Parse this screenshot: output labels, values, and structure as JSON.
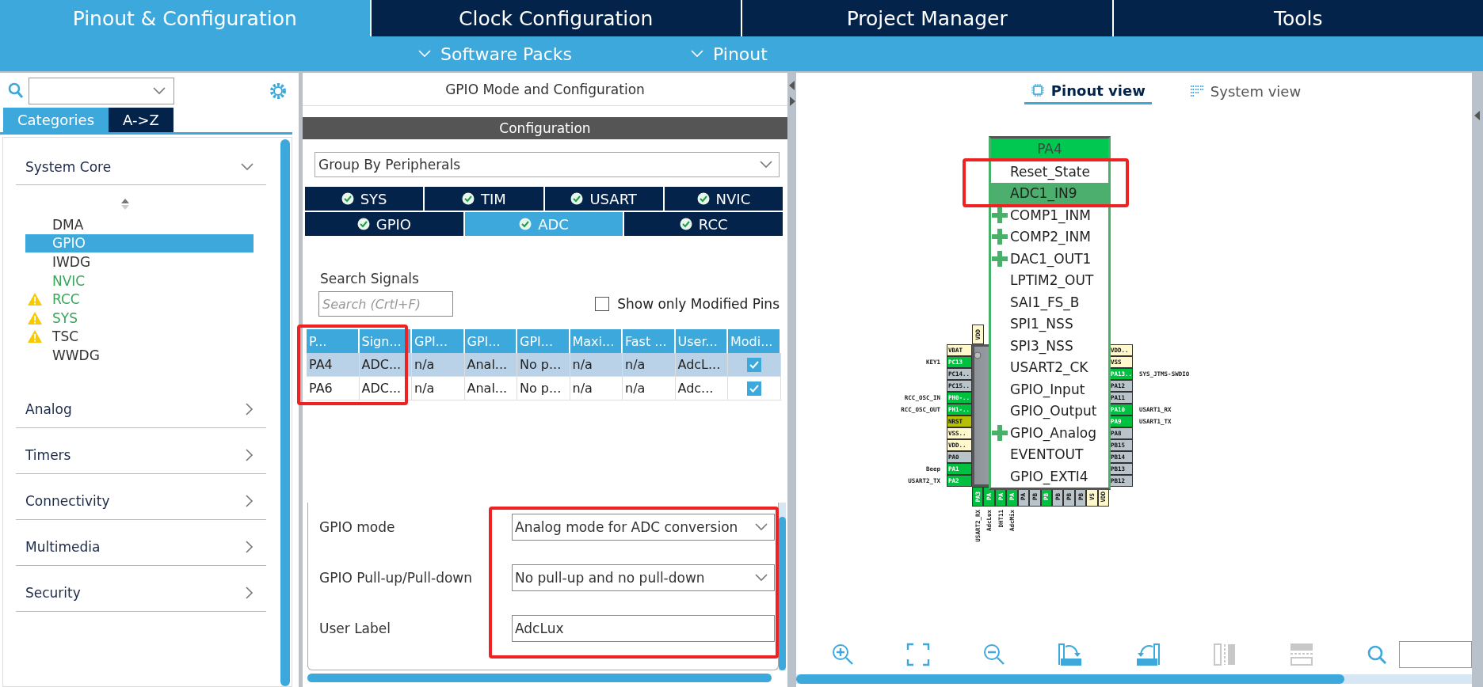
{
  "top_tabs": [
    {
      "label": "Pinout & Configuration",
      "selected": true
    },
    {
      "label": "Clock Configuration",
      "selected": false
    },
    {
      "label": "Project Manager",
      "selected": false
    },
    {
      "label": "Tools",
      "selected": false
    }
  ],
  "sub_menu": [
    {
      "label": "Software Packs"
    },
    {
      "label": "Pinout"
    }
  ],
  "left_tabs": [
    {
      "label": "Categories",
      "selected": true
    },
    {
      "label": "A->Z",
      "selected": false
    }
  ],
  "categories": [
    {
      "label": "System Core",
      "expanded": true,
      "items": [
        {
          "label": "DMA",
          "selected": false,
          "configured": false,
          "warning": false
        },
        {
          "label": "GPIO",
          "selected": true,
          "configured": false,
          "warning": false
        },
        {
          "label": "IWDG",
          "selected": false,
          "configured": false,
          "warning": false
        },
        {
          "label": "NVIC",
          "selected": false,
          "configured": true,
          "warning": false
        },
        {
          "label": "RCC",
          "selected": false,
          "configured": true,
          "warning": true
        },
        {
          "label": "SYS",
          "selected": false,
          "configured": true,
          "warning": true
        },
        {
          "label": "TSC",
          "selected": false,
          "configured": false,
          "warning": true
        },
        {
          "label": "WWDG",
          "selected": false,
          "configured": false,
          "warning": false
        }
      ]
    },
    {
      "label": "Analog",
      "expanded": false
    },
    {
      "label": "Timers",
      "expanded": false
    },
    {
      "label": "Connectivity",
      "expanded": false
    },
    {
      "label": "Multimedia",
      "expanded": false
    },
    {
      "label": "Security",
      "expanded": false
    }
  ],
  "middle": {
    "title": "GPIO Mode and Configuration",
    "section": "Configuration",
    "group_by": "Group By Peripherals",
    "peripheral_tabs": [
      [
        {
          "label": "SYS",
          "selected": false
        },
        {
          "label": "TIM",
          "selected": false
        },
        {
          "label": "USART",
          "selected": false
        },
        {
          "label": "NVIC",
          "selected": false
        }
      ],
      [
        {
          "label": "GPIO",
          "selected": false
        },
        {
          "label": "ADC",
          "selected": true
        },
        {
          "label": "RCC",
          "selected": false
        }
      ]
    ],
    "search_label": "Search Signals",
    "search_placeholder": "Search (Crtl+F)",
    "modified_only": {
      "label": "Show only Modified Pins",
      "checked": false
    },
    "table": {
      "columns": [
        "P...",
        "Sign...",
        "GPI...",
        "GPI...",
        "GPI...",
        "Maxi...",
        "Fast ...",
        "User...",
        "Modi..."
      ],
      "rows": [
        {
          "selected": true,
          "cells": [
            "PA4",
            "ADC...",
            "n/a",
            "Anal...",
            "No p...",
            "n/a",
            "n/a",
            "AdcL..."
          ],
          "modified": true
        },
        {
          "selected": false,
          "cells": [
            "PA6",
            "ADC...",
            "n/a",
            "Anal...",
            "No p...",
            "n/a",
            "n/a",
            "Adc..."
          ],
          "modified": true
        }
      ]
    },
    "form": [
      {
        "label": "GPIO mode",
        "kind": "select",
        "value": "Analog mode for ADC conversion"
      },
      {
        "label": "GPIO Pull-up/Pull-down",
        "kind": "select",
        "value": "No pull-up and no pull-down"
      },
      {
        "label": "User Label",
        "kind": "text",
        "value": "AdcLux"
      }
    ]
  },
  "pinout": {
    "views": [
      {
        "label": "Pinout view",
        "selected": true
      },
      {
        "label": "System view",
        "selected": false
      }
    ],
    "top_pins": [
      {
        "label": "VDD",
        "kind": "power"
      }
    ],
    "left_pins": [
      {
        "label": "VBAT",
        "kind": "power"
      },
      {
        "label": "PC13",
        "kind": "assigned",
        "signal": "KEY1"
      },
      {
        "label": "PC14..",
        "kind": "io"
      },
      {
        "label": "PC15..",
        "kind": "io"
      },
      {
        "label": "PH0-..",
        "kind": "assigned",
        "signal": "RCC_OSC_IN"
      },
      {
        "label": "PH1-..",
        "kind": "assigned",
        "signal": "RCC_OSC_OUT"
      },
      {
        "label": "NRST",
        "kind": "reset"
      },
      {
        "label": "VSS..",
        "kind": "power"
      },
      {
        "label": "VDD..",
        "kind": "power"
      },
      {
        "label": "PA0",
        "kind": "io"
      },
      {
        "label": "PA1",
        "kind": "assigned",
        "signal": "Beep"
      },
      {
        "label": "PA2",
        "kind": "assigned",
        "signal": "USART2_TX"
      }
    ],
    "right_pins": [
      {
        "label": "VDD..",
        "kind": "power"
      },
      {
        "label": "VSS",
        "kind": "power"
      },
      {
        "label": "PA13..",
        "kind": "assigned",
        "signal": "SYS_JTMS-SWDIO"
      },
      {
        "label": "PA12",
        "kind": "io"
      },
      {
        "label": "PA11",
        "kind": "io"
      },
      {
        "label": "PA10",
        "kind": "assigned",
        "signal": "USART1_RX"
      },
      {
        "label": "PA9",
        "kind": "assigned",
        "signal": "USART1_TX"
      },
      {
        "label": "PA8",
        "kind": "io"
      },
      {
        "label": "PB15",
        "kind": "io"
      },
      {
        "label": "PB14",
        "kind": "io"
      },
      {
        "label": "PB13",
        "kind": "io"
      },
      {
        "label": "PB12",
        "kind": "io"
      }
    ],
    "bottom_pins": [
      {
        "label": "PA3",
        "kind": "assigned",
        "signal": "USART2_RX"
      },
      {
        "label": "PA",
        "kind": "assigned",
        "signal": "AdcLux"
      },
      {
        "label": "PA",
        "kind": "assigned",
        "signal": "DHT11"
      },
      {
        "label": "PA",
        "kind": "assigned",
        "signal": "AdcMix"
      },
      {
        "label": "PA",
        "kind": "io"
      },
      {
        "label": "PB",
        "kind": "io"
      },
      {
        "label": "PB",
        "kind": "assigned"
      },
      {
        "label": "PB",
        "kind": "io"
      },
      {
        "label": "PB",
        "kind": "io"
      },
      {
        "label": "PB",
        "kind": "io"
      },
      {
        "label": "VS",
        "kind": "power"
      },
      {
        "label": "VDD",
        "kind": "power"
      }
    ],
    "pin_menu": {
      "pin": "PA4",
      "options": [
        {
          "label": "Reset_State",
          "selected": false,
          "plus": false
        },
        {
          "label": "ADC1_IN9",
          "selected": true,
          "plus": false
        },
        {
          "label": "COMP1_INM",
          "selected": false,
          "plus": true
        },
        {
          "label": "COMP2_INM",
          "selected": false,
          "plus": true
        },
        {
          "label": "DAC1_OUT1",
          "selected": false,
          "plus": true
        },
        {
          "label": "LPTIM2_OUT",
          "selected": false,
          "plus": false
        },
        {
          "label": "SAI1_FS_B",
          "selected": false,
          "plus": false
        },
        {
          "label": "SPI1_NSS",
          "selected": false,
          "plus": false
        },
        {
          "label": "SPI3_NSS",
          "selected": false,
          "plus": false
        },
        {
          "label": "USART2_CK",
          "selected": false,
          "plus": false
        },
        {
          "label": "GPIO_Input",
          "selected": false,
          "plus": false
        },
        {
          "label": "GPIO_Output",
          "selected": false,
          "plus": false
        },
        {
          "label": "GPIO_Analog",
          "selected": false,
          "plus": true
        },
        {
          "label": "EVENTOUT",
          "selected": false,
          "plus": false
        },
        {
          "label": "GPIO_EXTI4",
          "selected": false,
          "plus": false
        }
      ]
    }
  }
}
